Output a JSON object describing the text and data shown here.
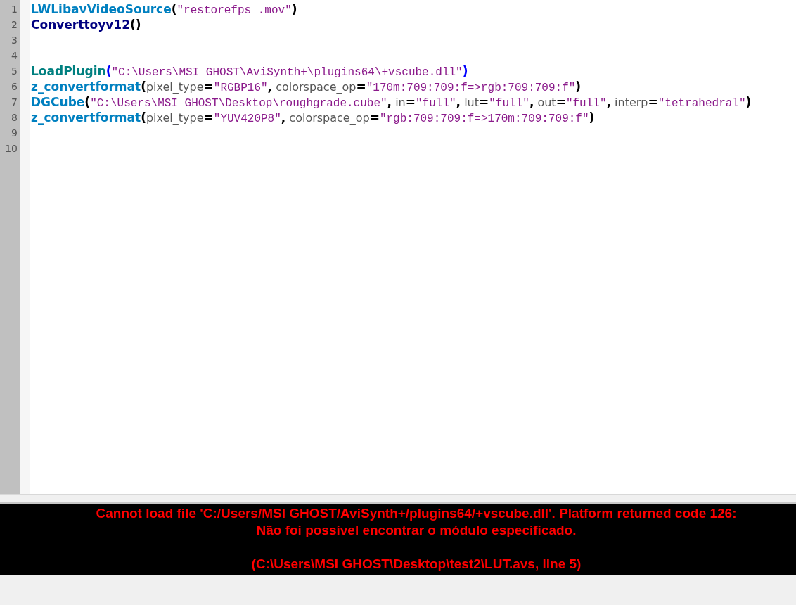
{
  "editor": {
    "lines": [
      {
        "number": "1",
        "tokens": [
          {
            "kind": "function",
            "text": "LWLibavVideoSource",
            "color": "#0080c0"
          },
          {
            "kind": "punct",
            "text": "(",
            "highlighted": false
          },
          {
            "kind": "string",
            "text": "\"restorefps .mov\""
          },
          {
            "kind": "punct",
            "text": ")",
            "highlighted": false
          }
        ]
      },
      {
        "number": "2",
        "tokens": [
          {
            "kind": "function",
            "text": "Converttoyv12",
            "color": "#000080"
          },
          {
            "kind": "punct",
            "text": "()",
            "highlighted": false
          }
        ]
      },
      {
        "number": "3"
      },
      {
        "number": "4"
      },
      {
        "number": "5",
        "tokens": [
          {
            "kind": "function",
            "text": "LoadPlugin",
            "color": "#008080"
          },
          {
            "kind": "punct",
            "text": "(",
            "highlighted": true
          },
          {
            "kind": "string",
            "text": "\"C:\\Users\\MSI GHOST\\AviSynth+\\plugins64\\+vscube.dll\""
          },
          {
            "kind": "punct",
            "text": ")",
            "highlighted": true
          }
        ]
      },
      {
        "number": "6",
        "tokens": [
          {
            "kind": "function",
            "text": "z_convertformat",
            "color": "#0080c0"
          },
          {
            "kind": "punct",
            "text": "(",
            "highlighted": false
          },
          {
            "kind": "param",
            "text": "pixel_type"
          },
          {
            "kind": "punct",
            "text": "=",
            "highlighted": false
          },
          {
            "kind": "string",
            "text": "\"RGBP16\""
          },
          {
            "kind": "punct",
            "text": ",",
            "highlighted": false
          },
          {
            "kind": "param",
            "text": " colorspace_op"
          },
          {
            "kind": "punct",
            "text": "=",
            "highlighted": false
          },
          {
            "kind": "string",
            "text": "\"170m:709:709:f=>rgb:709:709:f\""
          },
          {
            "kind": "punct",
            "text": ")",
            "highlighted": false
          }
        ]
      },
      {
        "number": "7",
        "tokens": [
          {
            "kind": "function",
            "text": "DGCube",
            "color": "#0080c0"
          },
          {
            "kind": "punct",
            "text": "(",
            "highlighted": false
          },
          {
            "kind": "string",
            "text": "\"C:\\Users\\MSI GHOST\\Desktop\\roughgrade.cube\""
          },
          {
            "kind": "punct",
            "text": ",",
            "highlighted": false
          },
          {
            "kind": "param",
            "text": " in"
          },
          {
            "kind": "punct",
            "text": "=",
            "highlighted": false
          },
          {
            "kind": "string",
            "text": "\"full\""
          },
          {
            "kind": "punct",
            "text": ",",
            "highlighted": false
          },
          {
            "kind": "param",
            "text": " lut"
          },
          {
            "kind": "punct",
            "text": "=",
            "highlighted": false
          },
          {
            "kind": "string",
            "text": "\"full\""
          },
          {
            "kind": "punct",
            "text": ",",
            "highlighted": false
          },
          {
            "kind": "param",
            "text": " out"
          },
          {
            "kind": "punct",
            "text": "=",
            "highlighted": false
          },
          {
            "kind": "string",
            "text": "\"full\""
          },
          {
            "kind": "punct",
            "text": ",",
            "highlighted": false
          },
          {
            "kind": "param",
            "text": " interp"
          },
          {
            "kind": "punct",
            "text": "=",
            "highlighted": false
          },
          {
            "kind": "string",
            "text": "\"tetrahedral\""
          },
          {
            "kind": "punct",
            "text": ")",
            "highlighted": false
          }
        ]
      },
      {
        "number": "8",
        "tokens": [
          {
            "kind": "function",
            "text": "z_convertformat",
            "color": "#0080c0"
          },
          {
            "kind": "punct",
            "text": "(",
            "highlighted": false
          },
          {
            "kind": "param",
            "text": "pixel_type"
          },
          {
            "kind": "punct",
            "text": "=",
            "highlighted": false
          },
          {
            "kind": "string",
            "text": "\"YUV420P8\""
          },
          {
            "kind": "punct",
            "text": ",",
            "highlighted": false
          },
          {
            "kind": "param",
            "text": " colorspace_op"
          },
          {
            "kind": "punct",
            "text": "=",
            "highlighted": false
          },
          {
            "kind": "string",
            "text": "\"rgb:709:709:f=>170m:709:709:f\""
          },
          {
            "kind": "punct",
            "text": ")",
            "highlighted": false
          }
        ]
      },
      {
        "number": "9"
      },
      {
        "number": "10"
      }
    ]
  },
  "error_panel": {
    "message": [
      "Cannot load file 'C:/Users/MSI GHOST/AviSynth+/plugins64/+vscube.dll'. Platform returned code 126:",
      "Não foi possível encontrar o módulo especificado."
    ],
    "location": "(C:\\Users\\MSI GHOST\\Desktop\\test2\\LUT.avs, line 5)"
  }
}
